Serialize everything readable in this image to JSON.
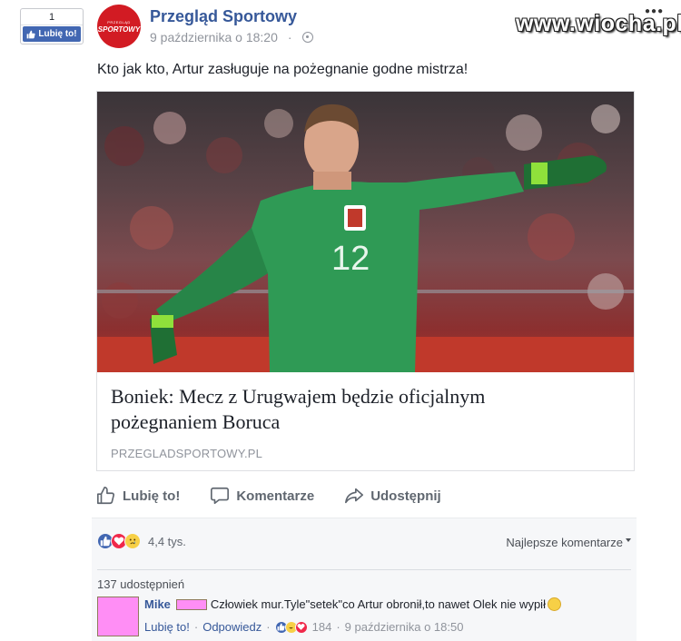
{
  "like_box": {
    "count": "1",
    "button_label": "Lubię to!"
  },
  "header": {
    "page_name": "Przegląd Sportowy",
    "timestamp": "9 października o 18:20",
    "avatar_text": "SPORTOWY",
    "avatar_subtext": "PRZEGLĄD"
  },
  "watermark": {
    "text": "www.wiocha.pl",
    "dots": "●●●"
  },
  "post": {
    "text": "Kto jak kto, Artur zasługuje na pożegnanie godne mistrza!"
  },
  "link_preview": {
    "title": "Boniek: Mecz z Urugwajem będzie oficjalnym pożegnaniem Boruca",
    "domain": "PRZEGLADSPORTOWY.PL",
    "photo_jersey_number": "12"
  },
  "actions": {
    "like": "Lubię to!",
    "comment": "Komentarze",
    "share": "Udostępnij"
  },
  "reactions": {
    "count": "4,4 tys.",
    "sort_label": "Najlepsze komentarze",
    "shares": "137 udostępnień",
    "colors": {
      "like": "#4267b2",
      "love": "#f0284a",
      "sad": "#f7d046"
    }
  },
  "comment": {
    "author": "Mike",
    "text": "Człowiek mur.Tyle\"setek\"co Artur obronił,to nawet Olek nie wypił",
    "like_link": "Lubię to!",
    "reply_link": "Odpowiedz",
    "reaction_count": "184",
    "timestamp": "9 października o 18:50",
    "redaction_color": "#ff8ef5"
  }
}
